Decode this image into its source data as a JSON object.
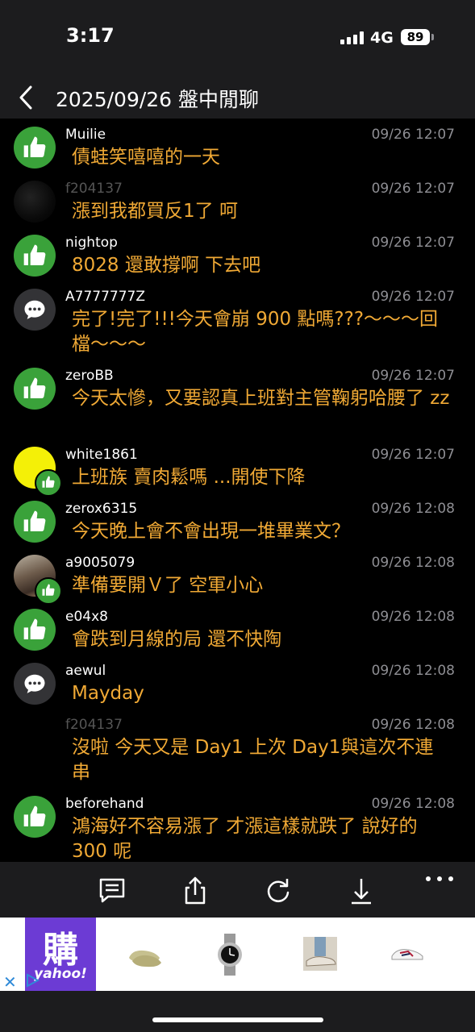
{
  "status_bar": {
    "time": "3:17",
    "network": "4G",
    "battery": "89"
  },
  "header": {
    "title": "2025/09/26 盤中閒聊",
    "back_icon": "chevron-left-icon"
  },
  "colors": {
    "message_text": "#f0a935",
    "like_green": "#3aa23a",
    "background": "#000000"
  },
  "messages": [
    {
      "user": "Muilie",
      "time": "09/26 12:07",
      "text": "債蛙笑嘻嘻的一天",
      "avatar": "thumbs-up-icon"
    },
    {
      "user": "f204137",
      "time": "09/26 12:07",
      "text": "漲到我都買反1了 呵",
      "avatar": "user-avatar"
    },
    {
      "user": "nightop",
      "time": "09/26 12:07",
      "text": "8028 還敢撐啊 下去吧",
      "avatar": "thumbs-up-icon"
    },
    {
      "user": "A7777777Z",
      "time": "09/26 12:07",
      "text": "完了!完了!!!今天會崩 900 點嗎???～～～回檔～～～",
      "avatar": "chat-bubble-icon"
    },
    {
      "user": "zeroBB",
      "time": "09/26 12:07",
      "text": "今天太慘，又要認真上班對主管鞠躬哈腰了 zz",
      "avatar": "thumbs-up-icon"
    },
    {
      "user": "white1861",
      "time": "09/26 12:07",
      "text": "上班族 賣肉鬆嗎 ...開使下降",
      "avatar": "user-avatar"
    },
    {
      "user": "zerox6315",
      "time": "09/26 12:08",
      "text": "今天晚上會不會出現一堆畢業文？",
      "avatar": "thumbs-up-icon"
    },
    {
      "user": "a9005079",
      "time": "09/26 12:08",
      "text": "準備要開Ｖ了 空軍小心",
      "avatar": "user-avatar"
    },
    {
      "user": "e04x8",
      "time": "09/26 12:08",
      "text": "會跌到月線的局 還不快陶",
      "avatar": "thumbs-up-icon"
    },
    {
      "user": "aewul",
      "time": "09/26 12:08",
      "text": "Mayday",
      "avatar": "chat-bubble-icon"
    },
    {
      "user": "f204137",
      "time": "09/26 12:08",
      "text": "沒啦 今天又是 Day1 上次 Day1與這次不連串",
      "avatar": "user-avatar"
    },
    {
      "user": "beforehand",
      "time": "09/26 12:08",
      "text": "鴻海好不容易漲了 才漲這樣就跌了 說好的 300 呢",
      "avatar": "thumbs-up-icon"
    }
  ],
  "toolbar": {
    "icons": [
      "comment-icon",
      "share-icon",
      "refresh-icon",
      "download-icon",
      "more-icon"
    ]
  },
  "ad": {
    "logo_glyph": "購",
    "brand": "yahoo!",
    "close_label": "✕"
  }
}
